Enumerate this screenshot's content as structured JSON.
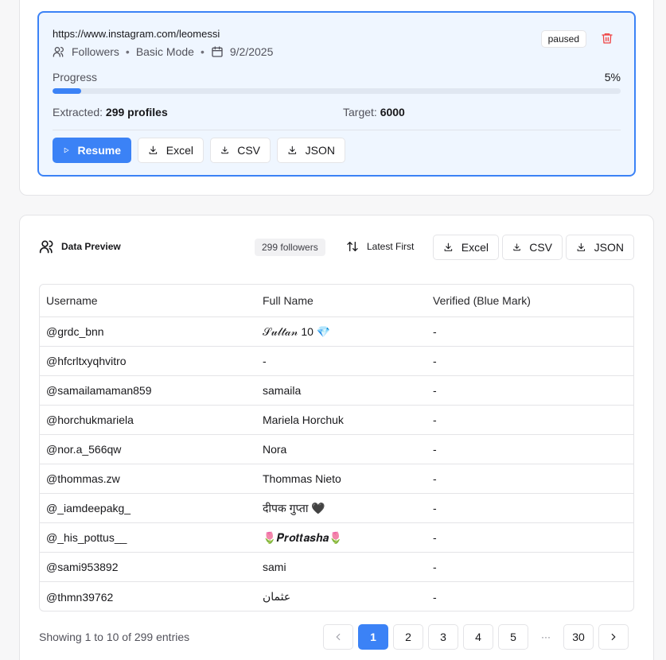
{
  "job": {
    "url": "https://www.instagram.com/leomessi",
    "type": "Followers",
    "mode": "Basic Mode",
    "date": "9/2/2025",
    "status": "paused",
    "progress_label": "Progress",
    "progress_percent": "5%",
    "progress_fraction": 0.05,
    "extracted_label": "Extracted:",
    "extracted_value": "299 profiles",
    "target_label": "Target:",
    "target_value": "6000",
    "actions": {
      "resume": "Resume",
      "excel": "Excel",
      "csv": "CSV",
      "json": "JSON"
    }
  },
  "preview": {
    "title": "Data Preview",
    "count": "299 followers",
    "sort": "Latest First",
    "actions": {
      "excel": "Excel",
      "csv": "CSV",
      "json": "JSON"
    },
    "columns": [
      "Username",
      "Full Name",
      "Verified (Blue Mark)"
    ],
    "rows": [
      [
        "@grdc_bnn",
        "𝒮𝓊𝓁𝓉𝒶𝓃 10 💎",
        "-"
      ],
      [
        "@hfcrltxyqhvitro",
        "-",
        "-"
      ],
      [
        "@samailamaman859",
        "samaila",
        "-"
      ],
      [
        "@horchukmariela",
        "Mariela Horchuk",
        "-"
      ],
      [
        "@nor.a_566qw",
        "Nora",
        "-"
      ],
      [
        "@thommas.zw",
        "Thommas Nieto",
        "-"
      ],
      [
        "@_iamdeepakg_",
        "दीपक गुप्ता 🖤",
        "-"
      ],
      [
        "@_his_pottus__",
        "🌷𝑷𝒓𝒐𝒕𝒕𝒂𝒔𝒉𝒂🌷",
        "-"
      ],
      [
        "@sami953892",
        "sami",
        "-"
      ],
      [
        "@thmn39762",
        "عثمان",
        "-"
      ]
    ],
    "showing": "Showing 1 to 10 of 299 entries",
    "pages": [
      "1",
      "2",
      "3",
      "4",
      "5"
    ],
    "ellipsis": "···",
    "last_page": "30",
    "current_page": "1"
  },
  "colors": {
    "accent": "#3b82f6",
    "danger": "#ef4444"
  }
}
